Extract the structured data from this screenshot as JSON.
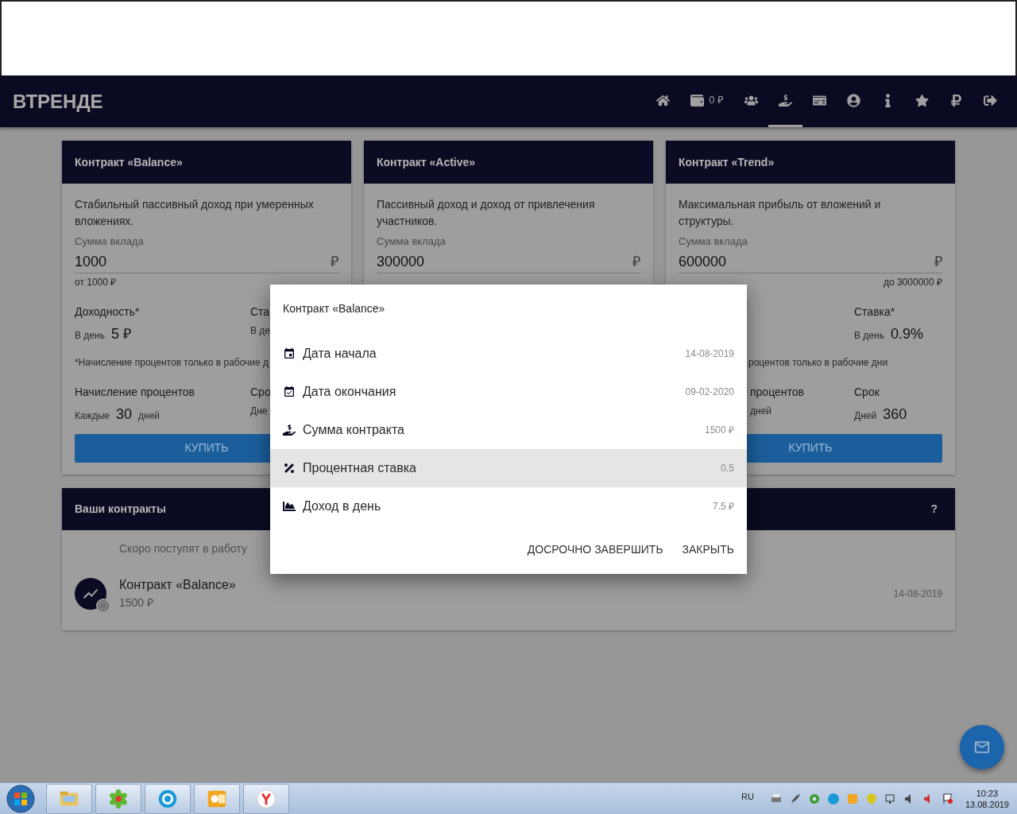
{
  "header": {
    "logo": "ВТРЕНДЕ",
    "nav": [
      {
        "selected": false
      },
      {
        "label": "0 ₽",
        "selected": false
      },
      {
        "selected": false
      },
      {
        "selected": true
      },
      {
        "selected": false
      },
      {
        "selected": false
      },
      {
        "selected": false
      },
      {
        "selected": false
      },
      {
        "selected": false
      },
      {
        "selected": false
      }
    ]
  },
  "cards": [
    {
      "title": "Контракт «Balance»",
      "covered_left": false,
      "description": "Стабильный пассивный доход при умеренных вложениях.",
      "amount_label": "Сумма вклада",
      "amount": "1000",
      "currency": "₽",
      "min": "от 1000 ₽",
      "stats_top": [
        {
          "label": "Доходность*",
          "prefix": "В день",
          "value": "5 ₽"
        },
        {
          "label": "Ста",
          "prefix": "В де"
        }
      ],
      "note": "*Начисление процентов только в рабочие д",
      "stats_bottom": [
        {
          "label": "Начисление процентов",
          "prefix": "Каждые",
          "value": "30",
          "suffix": "дней"
        },
        {
          "label": "Сро",
          "prefix": "Дне"
        }
      ],
      "buy": "КУПИТЬ"
    },
    {
      "title": "Контракт «Active»",
      "description": "Пассивный доход и доход от привлечения участников.",
      "amount_label": "Сумма вклада",
      "amount": "300000",
      "currency": "₽"
    },
    {
      "title": "Контракт «Trend»",
      "covered_left": true,
      "description": "Максимальная прибыль от вложений и структуры.",
      "amount_label": "Сумма вклада",
      "amount": "600000",
      "currency": "₽",
      "max": "до 3000000 ₽",
      "stats_top": [
        {
          "label": "Ставка*",
          "prefix": "В день",
          "value": "0.9%"
        }
      ],
      "note": "роцентов только в рабочие дни",
      "stats_bottom": [
        {
          "label": "процентов",
          "suffix": "дней"
        },
        {
          "label": "Срок",
          "prefix": "Дней",
          "value": "360"
        }
      ],
      "buy": "КУПИТЬ"
    }
  ],
  "contracts": {
    "title": "Ваши контракты",
    "help": "?",
    "subheader": "Скоро поступят в работу",
    "items": [
      {
        "name": "Контракт «Balance»",
        "amount": "1500 ₽",
        "date": "14-08-2019"
      }
    ]
  },
  "dialog": {
    "title": "Контракт «Balance»",
    "rows": [
      {
        "label": "Дата начала",
        "value": "14-08-2019",
        "selected": false
      },
      {
        "label": "Дата окончания",
        "value": "09-02-2020",
        "selected": false
      },
      {
        "label": "Сумма контракта",
        "value": "1500 ₽",
        "selected": false
      },
      {
        "label": "Процентная ставка",
        "value": "0.5",
        "selected": true
      },
      {
        "label": "Доход в день",
        "value": "7.5 ₽",
        "selected": false
      }
    ],
    "actions": [
      "ДОСРОЧНО ЗАВЕРШИТЬ",
      "ЗАКРЫТЬ"
    ]
  },
  "taskbar": {
    "language": "RU",
    "time": "10:23",
    "date": "13.08.2019"
  }
}
